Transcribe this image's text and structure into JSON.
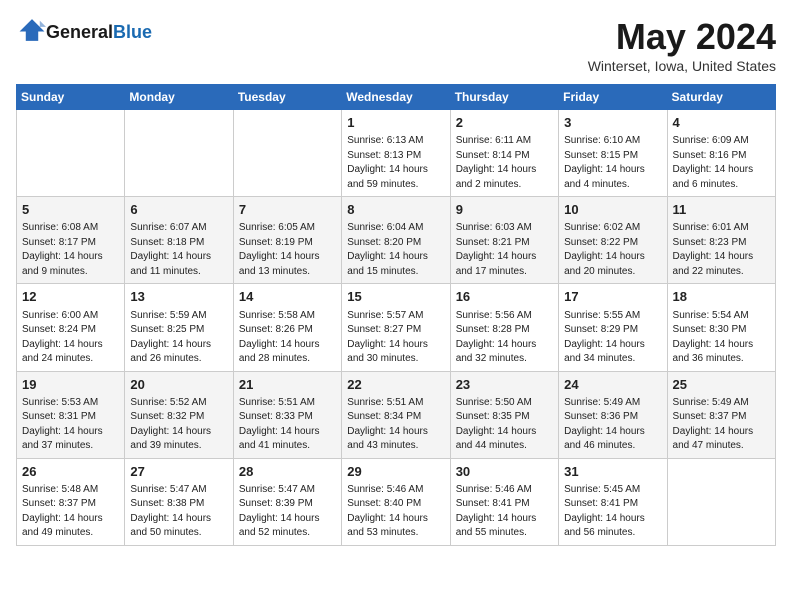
{
  "header": {
    "logo_general": "General",
    "logo_blue": "Blue",
    "month_title": "May 2024",
    "location": "Winterset, Iowa, United States"
  },
  "weekdays": [
    "Sunday",
    "Monday",
    "Tuesday",
    "Wednesday",
    "Thursday",
    "Friday",
    "Saturday"
  ],
  "weeks": [
    [
      null,
      null,
      null,
      {
        "day": "1",
        "sunrise": "Sunrise: 6:13 AM",
        "sunset": "Sunset: 8:13 PM",
        "daylight": "Daylight: 14 hours and 59 minutes."
      },
      {
        "day": "2",
        "sunrise": "Sunrise: 6:11 AM",
        "sunset": "Sunset: 8:14 PM",
        "daylight": "Daylight: 14 hours and 2 minutes."
      },
      {
        "day": "3",
        "sunrise": "Sunrise: 6:10 AM",
        "sunset": "Sunset: 8:15 PM",
        "daylight": "Daylight: 14 hours and 4 minutes."
      },
      {
        "day": "4",
        "sunrise": "Sunrise: 6:09 AM",
        "sunset": "Sunset: 8:16 PM",
        "daylight": "Daylight: 14 hours and 6 minutes."
      }
    ],
    [
      {
        "day": "5",
        "sunrise": "Sunrise: 6:08 AM",
        "sunset": "Sunset: 8:17 PM",
        "daylight": "Daylight: 14 hours and 9 minutes."
      },
      {
        "day": "6",
        "sunrise": "Sunrise: 6:07 AM",
        "sunset": "Sunset: 8:18 PM",
        "daylight": "Daylight: 14 hours and 11 minutes."
      },
      {
        "day": "7",
        "sunrise": "Sunrise: 6:05 AM",
        "sunset": "Sunset: 8:19 PM",
        "daylight": "Daylight: 14 hours and 13 minutes."
      },
      {
        "day": "8",
        "sunrise": "Sunrise: 6:04 AM",
        "sunset": "Sunset: 8:20 PM",
        "daylight": "Daylight: 14 hours and 15 minutes."
      },
      {
        "day": "9",
        "sunrise": "Sunrise: 6:03 AM",
        "sunset": "Sunset: 8:21 PM",
        "daylight": "Daylight: 14 hours and 17 minutes."
      },
      {
        "day": "10",
        "sunrise": "Sunrise: 6:02 AM",
        "sunset": "Sunset: 8:22 PM",
        "daylight": "Daylight: 14 hours and 20 minutes."
      },
      {
        "day": "11",
        "sunrise": "Sunrise: 6:01 AM",
        "sunset": "Sunset: 8:23 PM",
        "daylight": "Daylight: 14 hours and 22 minutes."
      }
    ],
    [
      {
        "day": "12",
        "sunrise": "Sunrise: 6:00 AM",
        "sunset": "Sunset: 8:24 PM",
        "daylight": "Daylight: 14 hours and 24 minutes."
      },
      {
        "day": "13",
        "sunrise": "Sunrise: 5:59 AM",
        "sunset": "Sunset: 8:25 PM",
        "daylight": "Daylight: 14 hours and 26 minutes."
      },
      {
        "day": "14",
        "sunrise": "Sunrise: 5:58 AM",
        "sunset": "Sunset: 8:26 PM",
        "daylight": "Daylight: 14 hours and 28 minutes."
      },
      {
        "day": "15",
        "sunrise": "Sunrise: 5:57 AM",
        "sunset": "Sunset: 8:27 PM",
        "daylight": "Daylight: 14 hours and 30 minutes."
      },
      {
        "day": "16",
        "sunrise": "Sunrise: 5:56 AM",
        "sunset": "Sunset: 8:28 PM",
        "daylight": "Daylight: 14 hours and 32 minutes."
      },
      {
        "day": "17",
        "sunrise": "Sunrise: 5:55 AM",
        "sunset": "Sunset: 8:29 PM",
        "daylight": "Daylight: 14 hours and 34 minutes."
      },
      {
        "day": "18",
        "sunrise": "Sunrise: 5:54 AM",
        "sunset": "Sunset: 8:30 PM",
        "daylight": "Daylight: 14 hours and 36 minutes."
      }
    ],
    [
      {
        "day": "19",
        "sunrise": "Sunrise: 5:53 AM",
        "sunset": "Sunset: 8:31 PM",
        "daylight": "Daylight: 14 hours and 37 minutes."
      },
      {
        "day": "20",
        "sunrise": "Sunrise: 5:52 AM",
        "sunset": "Sunset: 8:32 PM",
        "daylight": "Daylight: 14 hours and 39 minutes."
      },
      {
        "day": "21",
        "sunrise": "Sunrise: 5:51 AM",
        "sunset": "Sunset: 8:33 PM",
        "daylight": "Daylight: 14 hours and 41 minutes."
      },
      {
        "day": "22",
        "sunrise": "Sunrise: 5:51 AM",
        "sunset": "Sunset: 8:34 PM",
        "daylight": "Daylight: 14 hours and 43 minutes."
      },
      {
        "day": "23",
        "sunrise": "Sunrise: 5:50 AM",
        "sunset": "Sunset: 8:35 PM",
        "daylight": "Daylight: 14 hours and 44 minutes."
      },
      {
        "day": "24",
        "sunrise": "Sunrise: 5:49 AM",
        "sunset": "Sunset: 8:36 PM",
        "daylight": "Daylight: 14 hours and 46 minutes."
      },
      {
        "day": "25",
        "sunrise": "Sunrise: 5:49 AM",
        "sunset": "Sunset: 8:37 PM",
        "daylight": "Daylight: 14 hours and 47 minutes."
      }
    ],
    [
      {
        "day": "26",
        "sunrise": "Sunrise: 5:48 AM",
        "sunset": "Sunset: 8:37 PM",
        "daylight": "Daylight: 14 hours and 49 minutes."
      },
      {
        "day": "27",
        "sunrise": "Sunrise: 5:47 AM",
        "sunset": "Sunset: 8:38 PM",
        "daylight": "Daylight: 14 hours and 50 minutes."
      },
      {
        "day": "28",
        "sunrise": "Sunrise: 5:47 AM",
        "sunset": "Sunset: 8:39 PM",
        "daylight": "Daylight: 14 hours and 52 minutes."
      },
      {
        "day": "29",
        "sunrise": "Sunrise: 5:46 AM",
        "sunset": "Sunset: 8:40 PM",
        "daylight": "Daylight: 14 hours and 53 minutes."
      },
      {
        "day": "30",
        "sunrise": "Sunrise: 5:46 AM",
        "sunset": "Sunset: 8:41 PM",
        "daylight": "Daylight: 14 hours and 55 minutes."
      },
      {
        "day": "31",
        "sunrise": "Sunrise: 5:45 AM",
        "sunset": "Sunset: 8:41 PM",
        "daylight": "Daylight: 14 hours and 56 minutes."
      },
      null
    ]
  ]
}
